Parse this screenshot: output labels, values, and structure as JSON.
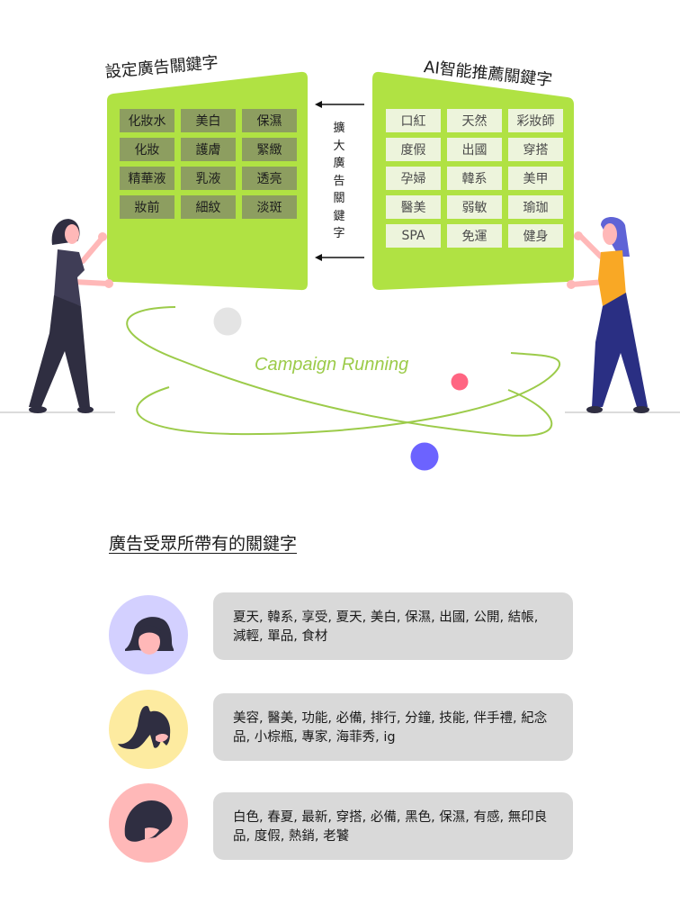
{
  "left_panel": {
    "title": "設定廣告關鍵字",
    "color": "#b0e243",
    "tile_color": "#8d9e60",
    "keywords": [
      "化妝水",
      "美白",
      "保濕",
      "化妝",
      "護膚",
      "緊緻",
      "精華液",
      "乳液",
      "透亮",
      "妝前",
      "細紋",
      "淡斑"
    ]
  },
  "right_panel": {
    "title": "AI智能推薦關鍵字",
    "color": "#b0e243",
    "tile_color": "#edf4dc",
    "keywords": [
      "口紅",
      "天然",
      "彩妝師",
      "度假",
      "出國",
      "穿搭",
      "孕婦",
      "韓系",
      "美甲",
      "醫美",
      "弱敏",
      "瑜珈",
      "SPA",
      "免運",
      "健身"
    ]
  },
  "expand": {
    "label": "擴大廣告關鍵字",
    "arrow_icons": [
      "arrow-left-icon",
      "arrow-left-icon"
    ]
  },
  "campaign": {
    "label": "Campaign Running",
    "color": "#9ccb4a",
    "dots": [
      {
        "name": "gray-dot",
        "color": "#e4e4e4"
      },
      {
        "name": "pink-dot",
        "color": "#ff6582"
      },
      {
        "name": "blue-dot",
        "color": "#6c63ff"
      }
    ]
  },
  "figures": {
    "left_person": {
      "shirt": "#3f3d56",
      "pants": "#2f2e41",
      "skin": "#ffb8b8",
      "hair": "#2f2e41"
    },
    "right_person": {
      "shirt": "#f9a825",
      "pants": "#2a2f83",
      "skin": "#ffb8b8",
      "hair": "#5f63d6"
    }
  },
  "audience": {
    "title": "廣告受眾所帶有的關鍵字",
    "rows": [
      {
        "avatar_color": "#d3d0ff",
        "avatar_icon": "user-short-hair-icon",
        "keywords_text": "夏天, 韓系, 享受, 夏天, 美白, 保濕, 出國, 公開, 結帳, 減輕, 單品, 食材"
      },
      {
        "avatar_color": "#fdeba0",
        "avatar_icon": "user-ponytail-icon",
        "keywords_text": "美容, 醫美, 功能, 必備, 排行, 分鐘, 技能, 伴手禮, 紀念品, 小棕瓶, 專家, 海菲秀, ig"
      },
      {
        "avatar_color": "#ffb8b8",
        "avatar_icon": "user-bob-hair-icon",
        "keywords_text": "白色, 春夏, 最新, 穿搭, 必備, 黑色, 保濕, 有感, 無印良品, 度假, 熱銷, 老饕"
      }
    ]
  }
}
